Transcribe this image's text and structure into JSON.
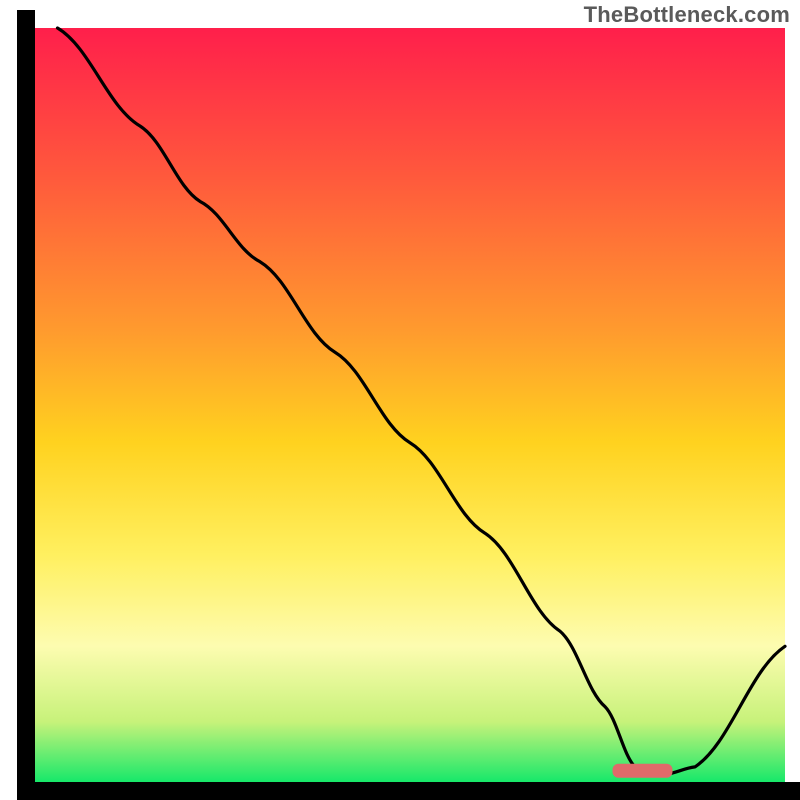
{
  "watermark": "TheBottleneck.com",
  "chart_data": {
    "type": "line",
    "title": "",
    "xlabel": "",
    "ylabel": "",
    "xlim": [
      0,
      100
    ],
    "ylim": [
      0,
      100
    ],
    "grid": false,
    "legend": false,
    "annotations": [],
    "gradient_stops": [
      {
        "offset": 0.0,
        "color": "#ff1f4b"
      },
      {
        "offset": 0.2,
        "color": "#ff5a3c"
      },
      {
        "offset": 0.4,
        "color": "#ff9a2e"
      },
      {
        "offset": 0.55,
        "color": "#ffd21f"
      },
      {
        "offset": 0.7,
        "color": "#fff060"
      },
      {
        "offset": 0.82,
        "color": "#fdfcb0"
      },
      {
        "offset": 0.92,
        "color": "#c7f27a"
      },
      {
        "offset": 1.0,
        "color": "#17e86a"
      }
    ],
    "line": {
      "x": [
        3,
        14,
        22,
        30,
        40,
        50,
        60,
        70,
        76,
        80,
        84,
        88,
        100
      ],
      "y": [
        100,
        87,
        77,
        69,
        57,
        45,
        33,
        20,
        10,
        2,
        1,
        2,
        18
      ]
    },
    "marker": {
      "shape": "rounded-bar",
      "x_start": 77,
      "x_end": 85,
      "y": 1.5,
      "color": "#e06a6a"
    }
  }
}
